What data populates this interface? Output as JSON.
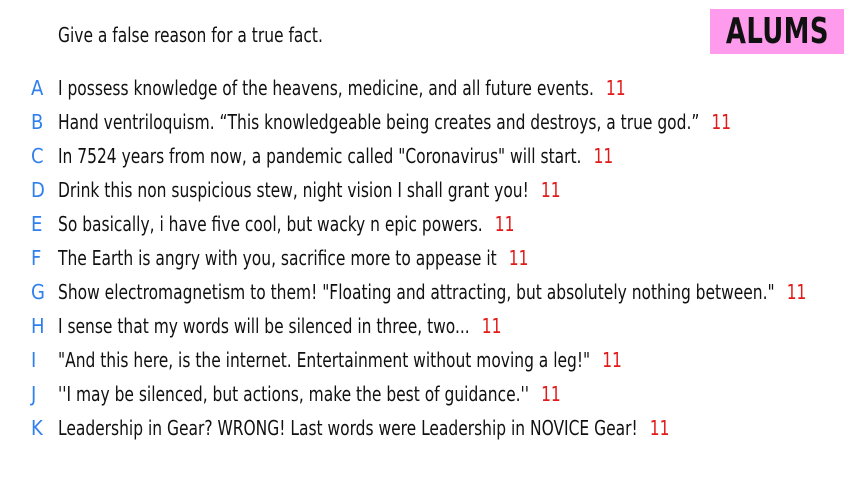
{
  "prompt": "Give a false reason for a true fact.",
  "team": {
    "name": "ALUMS",
    "color": "#ff9bed"
  },
  "colors": {
    "letter": "#2f80ed",
    "score": "#e11a1a"
  },
  "answers": [
    {
      "letter": "A",
      "text": "I possess knowledge of the heavens, medicine, and all future events.",
      "score": "11"
    },
    {
      "letter": "B",
      "text": "Hand ventriloquism. “This knowledgeable being creates and destroys, a true god.”",
      "score": "11"
    },
    {
      "letter": "C",
      "text": "In 7524 years from now, a pandemic called \"Coronavirus\" will start.",
      "score": "11"
    },
    {
      "letter": "D",
      "text": "Drink this non suspicious stew, night vision I shall grant you!",
      "score": "11"
    },
    {
      "letter": "E",
      "text": "So basically, i have five cool, but wacky n epic powers.",
      "score": "11"
    },
    {
      "letter": "F",
      "text": "The Earth is angry with you, sacrifice more to appease it",
      "score": "11"
    },
    {
      "letter": "G",
      "text": "Show electromagnetism to them! \"Floating and attracting, but absolutely nothing between.\"",
      "score": "11"
    },
    {
      "letter": "H",
      "text": "I sense that my words will be silenced in three, two...",
      "score": "11"
    },
    {
      "letter": "I",
      "text": "\"And this here, is the internet. Entertainment without moving a leg!\"",
      "score": "11"
    },
    {
      "letter": "J",
      "text": "''I may be silenced, but actions, make the best of guidance.''",
      "score": "11"
    },
    {
      "letter": "K",
      "text": "Leadership in Gear? WRONG! Last words were Leadership in NOVICE Gear!",
      "score": "11"
    }
  ]
}
